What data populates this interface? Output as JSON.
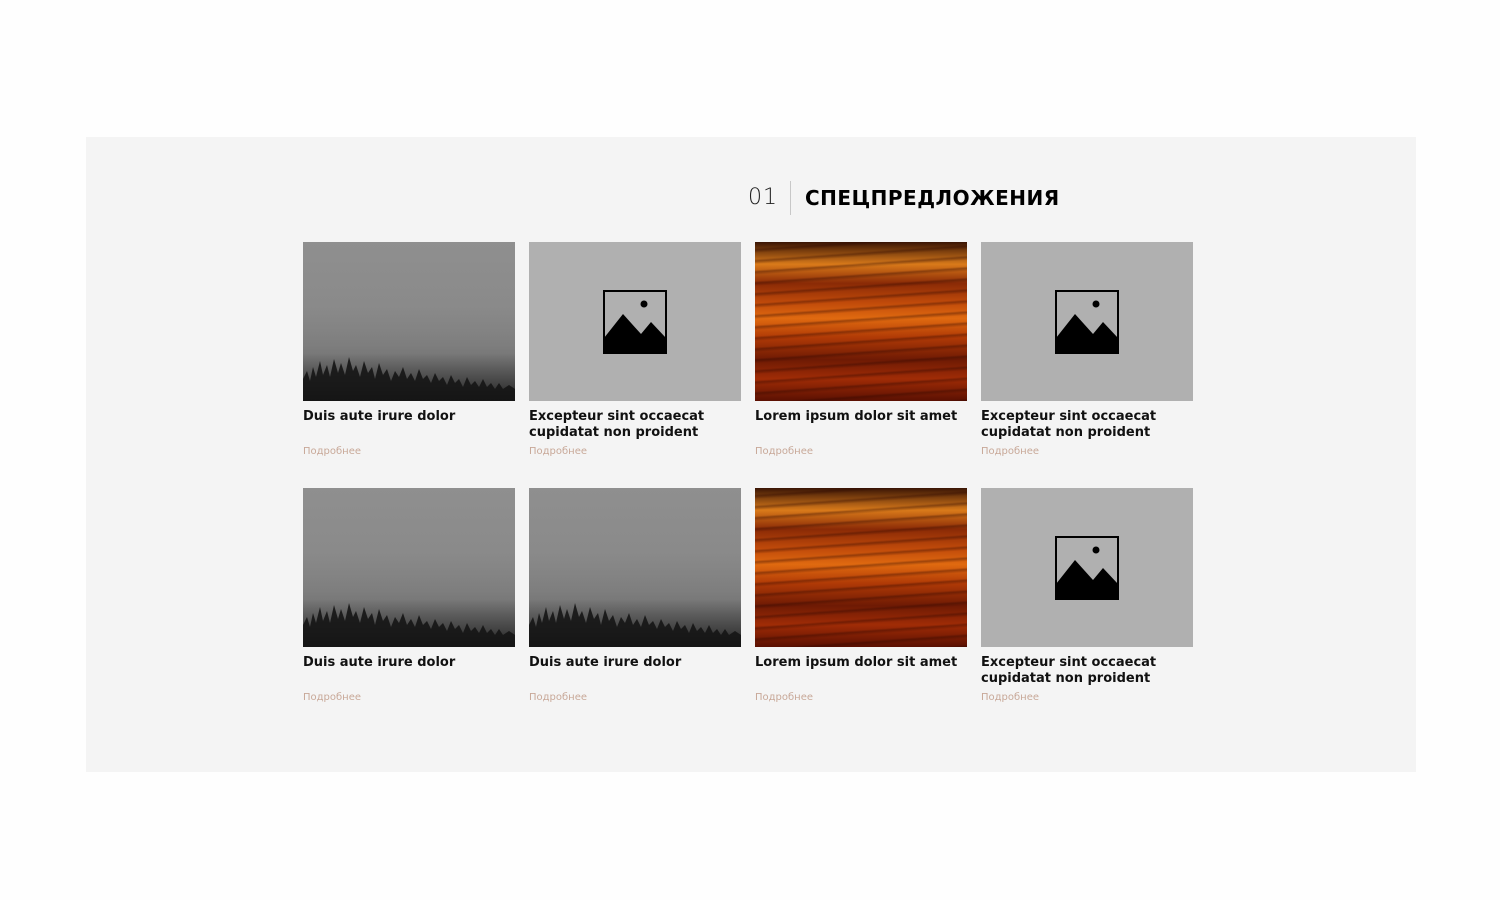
{
  "section": {
    "number": "01",
    "title": "СПЕЦПРЕДЛОЖЕНИЯ"
  },
  "cards": [
    {
      "image": "fog-forest",
      "title": "Duis aute irure dolor",
      "more": "Подробнее"
    },
    {
      "image": "placeholder",
      "title": "Excepteur sint occaecat cupidatat non proident",
      "more": "Подробнее"
    },
    {
      "image": "sunset",
      "title": "Lorem ipsum dolor sit amet",
      "more": "Подробнее"
    },
    {
      "image": "placeholder",
      "title": "Excepteur sint occaecat cupidatat non proident",
      "more": "Подробнее"
    },
    {
      "image": "fog-forest",
      "title": "Duis aute irure dolor",
      "more": "Подробнее"
    },
    {
      "image": "fog-forest",
      "title": "Duis aute irure dolor",
      "more": "Подробнее"
    },
    {
      "image": "sunset",
      "title": "Lorem ipsum dolor sit amet",
      "more": "Подробнее"
    },
    {
      "image": "placeholder",
      "title": "Excepteur sint occaecat cupidatat non proident",
      "more": "Подробнее"
    }
  ],
  "colors": {
    "section_bg": "#f4f4f4",
    "placeholder_bg": "#b0b0b0",
    "more_link": "#c8a898"
  }
}
